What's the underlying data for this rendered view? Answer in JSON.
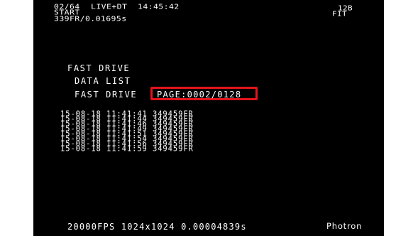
{
  "status": {
    "frame_counter": "02/64",
    "mode": "LIVE+DT",
    "clock": "14:45:42",
    "trigger": "START",
    "frames_duration": "339FR/0.01695s",
    "corner_top": "12B",
    "corner_bottom": "FIT"
  },
  "menu": {
    "title": "FAST DRIVE",
    "subtitle": "DATA LIST",
    "section": "FAST DRIVE",
    "page_indicator": "PAGE:0002/0128"
  },
  "records": [
    "15-08-18 11:41:41 349459FR",
    "15-08-18 11:41:44 349459FR",
    "15-08-18 11:41:46 349459FR",
    "15-08-18 11:41:49 349459FR",
    "15-08-18 11:41:51 349459FR",
    "15-08-18 11:41:54 349459FR",
    "15-08-18 11:41:56 349459FR",
    "15-08-18 11:41:59 349459FR"
  ],
  "footer": {
    "recording_info": "20000FPS 1024x1024 0.00004839s",
    "brand": "Photron"
  },
  "colors": {
    "background": "#000000",
    "text": "#ffffff",
    "highlight": "#e3141b"
  }
}
